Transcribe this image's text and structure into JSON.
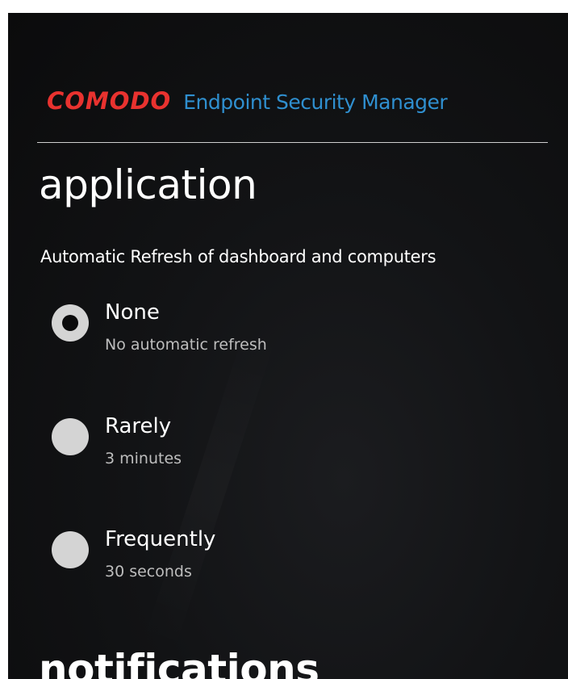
{
  "header": {
    "brand": "COMODO",
    "product": "Endpoint Security Manager"
  },
  "page": {
    "title": "application"
  },
  "refresh": {
    "label": "Automatic Refresh of dashboard and computers",
    "options": [
      {
        "title": "None",
        "subtitle": "No automatic refresh",
        "selected": true
      },
      {
        "title": "Rarely",
        "subtitle": "3 minutes",
        "selected": false
      },
      {
        "title": "Frequently",
        "subtitle": "30 seconds",
        "selected": false
      }
    ]
  },
  "next_section": {
    "title": "notifications"
  },
  "colors": {
    "brand": "#e8322f",
    "product": "#2f8fcf",
    "background": "#121315",
    "radio": "#d4d4d4"
  }
}
